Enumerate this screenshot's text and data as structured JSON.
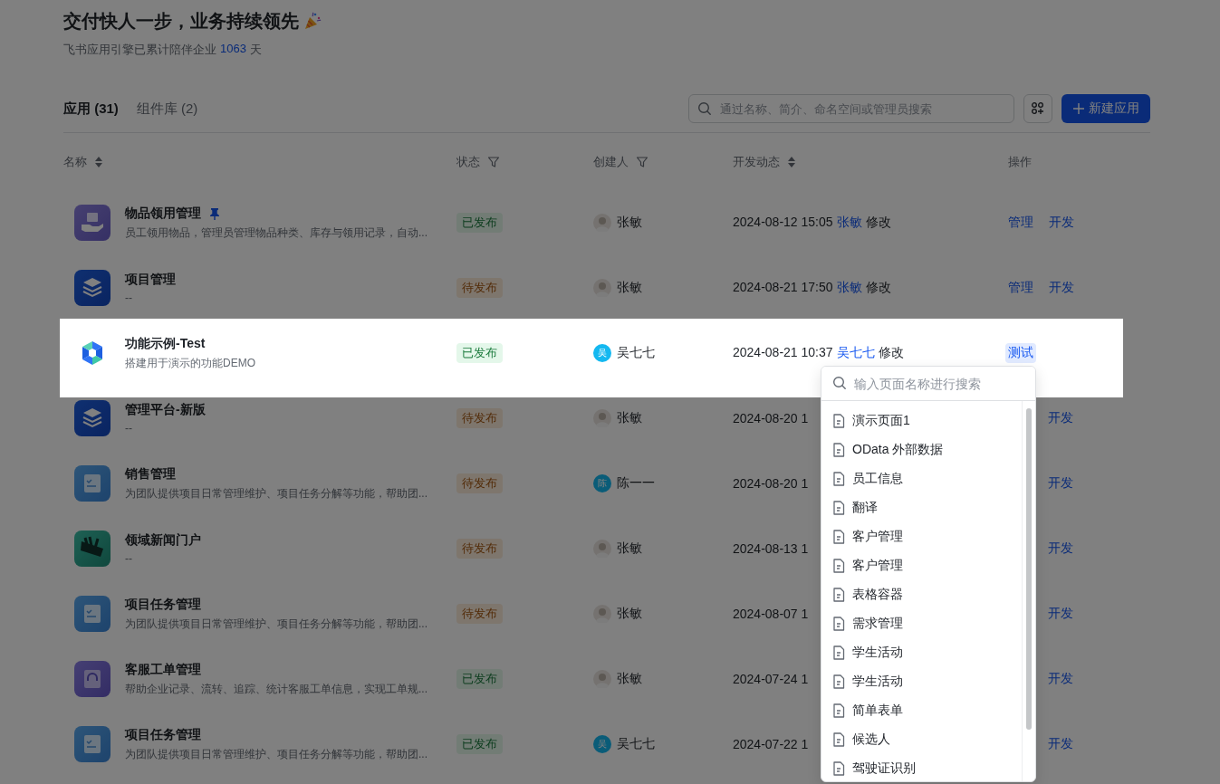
{
  "hero": {
    "title": "交付快人一步，业务持续领先",
    "subtitle": "飞书应用引擎已累计陪伴企业",
    "days": "1063",
    "days_unit": "天"
  },
  "tabs": [
    {
      "label": "应用 (31)",
      "selected": true
    },
    {
      "label": "组件库 (2)",
      "selected": false
    }
  ],
  "search": {
    "placeholder": "通过名称、简介、命名空间或管理员搜索"
  },
  "new_button": "新建应用",
  "table": {
    "columns": [
      {
        "label": "名称",
        "sortable": true,
        "filterable": false
      },
      {
        "label": "状态",
        "sortable": false,
        "filterable": true
      },
      {
        "label": "创建人",
        "sortable": false,
        "filterable": true
      },
      {
        "label": "开发动态",
        "sortable": true,
        "filterable": false
      },
      {
        "label": "操作",
        "sortable": false,
        "filterable": false
      }
    ],
    "rows": [
      {
        "kind": "box-hand",
        "name": "物品领用管理",
        "pinned": true,
        "description": "员工领用物品，管理员管理物品种类、库存与领用记录，自动...",
        "status": "已发布",
        "published": true,
        "creator": "张敏",
        "date": "2024-08-12 15:05",
        "editor": "张敏",
        "action": "修改",
        "highlighted": false,
        "covered": false,
        "ops": [
          {
            "label": "管理",
            "active": false
          },
          {
            "label": "开发",
            "active": false
          }
        ]
      },
      {
        "kind": "layers",
        "name": "项目管理",
        "pinned": false,
        "description": "--",
        "status": "待发布",
        "published": false,
        "creator": "张敏",
        "date": "2024-08-21 17:50",
        "editor": "张敏",
        "action": "修改",
        "highlighted": false,
        "covered": false,
        "ops": [
          {
            "label": "管理",
            "active": false
          },
          {
            "label": "开发",
            "active": false
          }
        ]
      },
      {
        "kind": "logo",
        "name": "功能示例-Test",
        "pinned": false,
        "description": "搭建用于演示的功能DEMO",
        "status": "已发布",
        "published": true,
        "creator": "吴七七",
        "avatar_text": "吴",
        "date": "2024-08-21 10:37",
        "editor": "吴七七",
        "action": "修改",
        "highlighted": true,
        "covered": false,
        "ops": [
          {
            "label": "测试",
            "active": true
          }
        ]
      },
      {
        "kind": "layers",
        "name": "管理平台-新版",
        "pinned": false,
        "description": "--",
        "status": "待发布",
        "published": false,
        "creator": "张敏",
        "date": "2024-08-20 1",
        "highlighted": false,
        "covered": true,
        "ops": [
          {
            "label": "开发",
            "active": false
          }
        ]
      },
      {
        "kind": "doc",
        "name": "销售管理",
        "pinned": false,
        "description": "为团队提供项目日常管理维护、项目任务分解等功能，帮助团...",
        "status": "待发布",
        "published": false,
        "creator": "陈一一",
        "avatar_text": "陈",
        "date": "2024-08-20 1",
        "highlighted": false,
        "covered": true,
        "ops": [
          {
            "label": "开发",
            "active": false
          }
        ]
      },
      {
        "kind": "news",
        "name": "领域新闻门户",
        "pinned": false,
        "description": "--",
        "status": "待发布",
        "published": false,
        "creator": "张敏",
        "date": "2024-08-13 1",
        "highlighted": false,
        "covered": true,
        "ops": [
          {
            "label": "开发",
            "active": false
          }
        ]
      },
      {
        "kind": "doc",
        "name": "项目任务管理",
        "pinned": false,
        "description": "为团队提供项目日常管理维护、项目任务分解等功能，帮助团...",
        "status": "待发布",
        "published": false,
        "creator": "张敏",
        "date": "2024-08-07 1",
        "highlighted": false,
        "covered": true,
        "ops": [
          {
            "label": "开发",
            "active": false
          }
        ]
      },
      {
        "kind": "headset",
        "name": "客服工单管理",
        "pinned": false,
        "description": "帮助企业记录、流转、追踪、统计客服工单信息，实现工单规...",
        "status": "已发布",
        "published": true,
        "creator": "张敏",
        "date": "2024-07-24 1",
        "highlighted": false,
        "covered": true,
        "ops": [
          {
            "label": "开发",
            "active": false
          }
        ]
      },
      {
        "kind": "doc",
        "name": "项目任务管理",
        "pinned": false,
        "description": "为团队提供项目日常管理维护、项目任务分解等功能，帮助团...",
        "status": "已发布",
        "published": true,
        "creator": "吴七七",
        "avatar_text": "吴",
        "date": "2024-07-22 1",
        "highlighted": false,
        "covered": true,
        "ops": [
          {
            "label": "开发",
            "active": false
          }
        ]
      }
    ]
  },
  "page_dropdown": {
    "placeholder": "输入页面名称进行搜索",
    "items": [
      "演示页面1",
      "OData 外部数据",
      "员工信息",
      "翻译",
      "客户管理",
      "客户管理",
      "表格容器",
      "需求管理",
      "学生活动",
      "学生活动",
      "简单表单",
      "候选人",
      "驾驶证识别"
    ]
  }
}
